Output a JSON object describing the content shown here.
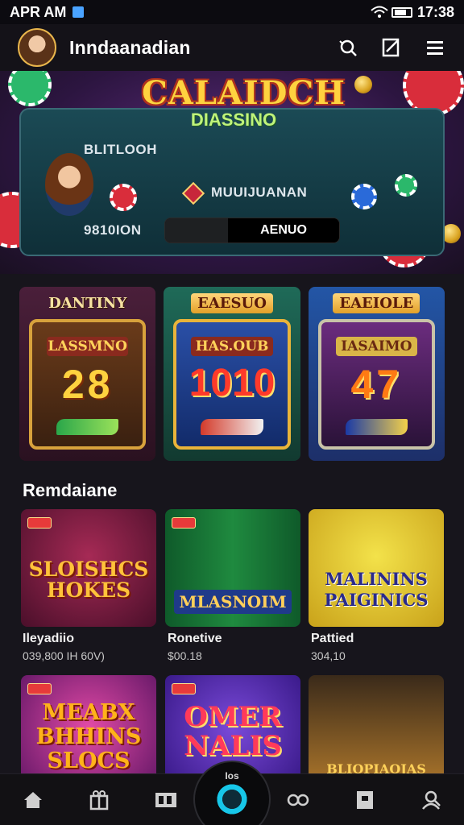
{
  "status_bar": {
    "time_left": "APR AM",
    "time_right": "17:38",
    "icons": [
      "app-notification-icon",
      "wifi-icon",
      "battery-icon"
    ]
  },
  "header": {
    "title": "Inndaanadian",
    "actions": [
      "search-icon",
      "share-icon",
      "menu-icon"
    ]
  },
  "hero": {
    "logo_main": "CALAIDCH",
    "logo_sub": "DIASSINO",
    "line_1": "BLITLOOH",
    "line_2": "MUUIJUANAN",
    "line_3": "9810ION",
    "toggle_right": "AENUO"
  },
  "featured_slots": [
    {
      "label": "DANTINY",
      "reel_title": "LASSMNO",
      "numbers": "28"
    },
    {
      "label": "EAESUO",
      "reel_title": "HAS.OUB",
      "numbers": "1010"
    },
    {
      "label": "EAEIOLE",
      "reel_title": "IASAIMO",
      "numbers": "47"
    }
  ],
  "section": {
    "title": "Remdaiane"
  },
  "games": [
    {
      "thumb_title": "SLOISHCS\nHOKES",
      "name": "Ileyadiio",
      "meta": "039,800  IH 60V)"
    },
    {
      "thumb_title": "MLASNOIM",
      "name": "Ronetive",
      "meta": "$00.18"
    },
    {
      "thumb_title": "MALININS\nPAIGINICS",
      "name": "Pattied",
      "meta": "304,10"
    },
    {
      "thumb_title": "MEABX\nBHHINS\nSLOCS",
      "name": "",
      "meta": ""
    },
    {
      "thumb_title": "OMER\nNALIS",
      "name": "",
      "meta": ""
    },
    {
      "thumb_title": "BLIOPIAOJAS",
      "name": "",
      "meta": ""
    }
  ],
  "tab_bar": {
    "tabs": [
      "home-icon",
      "gift-icon",
      "slots-icon",
      "center-play-icon",
      "cards-icon",
      "wallet-icon",
      "profile-icon"
    ],
    "center_label": "Ios"
  },
  "colors": {
    "background": "#17151c",
    "accent_gold": "#ffd23f",
    "accent_cyan": "#17c7e9"
  }
}
